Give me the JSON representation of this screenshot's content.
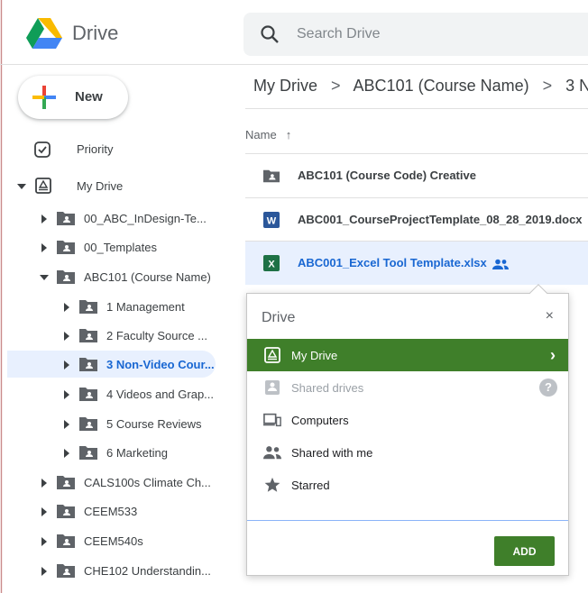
{
  "app": {
    "title": "Drive"
  },
  "search": {
    "placeholder": "Search Drive"
  },
  "new_button": {
    "label": "New"
  },
  "sidebar": {
    "priority": "Priority",
    "my_drive": "My Drive",
    "items": [
      {
        "label": "00_ABC_InDesign-Te..."
      },
      {
        "label": "00_Templates"
      },
      {
        "label": "ABC101 (Course Name)"
      },
      {
        "label": "1 Management"
      },
      {
        "label": "2 Faculty Source ..."
      },
      {
        "label": "3 Non-Video Cour..."
      },
      {
        "label": "4 Videos and Grap..."
      },
      {
        "label": "5 Course Reviews"
      },
      {
        "label": "6 Marketing"
      },
      {
        "label": "CALS100s Climate Ch..."
      },
      {
        "label": "CEEM533"
      },
      {
        "label": "CEEM540s"
      },
      {
        "label": "CHE102 Understandin..."
      }
    ]
  },
  "breadcrumb": {
    "root": "My Drive",
    "course": "ABC101 (Course Name)",
    "current": "3 N",
    "separator": ">"
  },
  "list": {
    "column_name": "Name",
    "sort_arrow": "↑",
    "files": [
      {
        "name": "ABC101 (Course Code) Creative",
        "type": "folder"
      },
      {
        "name": "ABC001_CourseProjectTemplate_08_28_2019.docx",
        "type": "word"
      },
      {
        "name": "ABC001_Excel Tool Template.xlsx",
        "type": "excel"
      }
    ]
  },
  "popup": {
    "title": "Drive",
    "close": "×",
    "items": [
      {
        "label": "My Drive",
        "icon": "drive-icon"
      },
      {
        "label": "Shared drives",
        "icon": "shared-drives-icon"
      },
      {
        "label": "Computers",
        "icon": "computers-icon"
      },
      {
        "label": "Shared with me",
        "icon": "people-icon"
      },
      {
        "label": "Starred",
        "icon": "star-icon"
      }
    ],
    "help": "?",
    "chevron": "›",
    "add": "ADD"
  },
  "colors": {
    "accent_green": "#3f7f2a",
    "selection_blue": "#e8f0fe",
    "link_blue": "#1967d2"
  }
}
